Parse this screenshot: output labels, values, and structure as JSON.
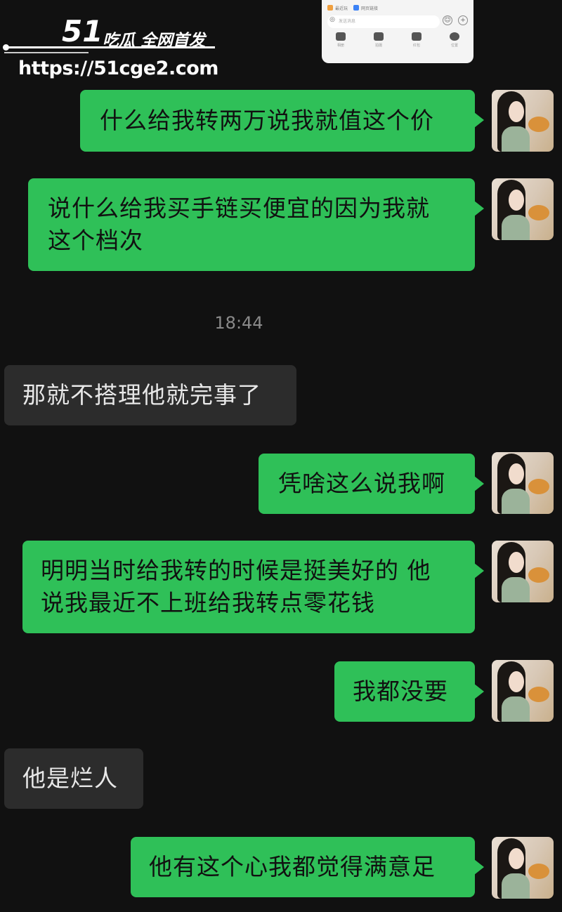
{
  "watermark": {
    "number": "51",
    "title": "吃瓜 全网首发",
    "url": "https://51cge2.com"
  },
  "embedded_card": {
    "chips": [
      "最近玩",
      "网页链接"
    ],
    "input_placeholder": "发送消息",
    "tools": [
      "相册",
      "拍摄",
      "红包",
      "位置"
    ]
  },
  "messages": [
    {
      "direction": "out",
      "text": "什么给我转两万说我就值这个价"
    },
    {
      "direction": "out",
      "line1": "说什么给我买手链买便宜的因为我就",
      "line2": "这个档次"
    },
    {
      "direction": "in",
      "text": "那就不搭理他就完事了"
    },
    {
      "direction": "out",
      "text": "凭啥这么说我啊"
    },
    {
      "direction": "out",
      "line1": "明明当时给我转的时候是挺美好的 他",
      "line2": "说我最近不上班给我转点零花钱"
    },
    {
      "direction": "out",
      "text": "我都没要"
    },
    {
      "direction": "in",
      "text": "他是烂人"
    },
    {
      "direction": "out",
      "text": "他有这个心我都觉得满意足"
    }
  ],
  "timestamp": "18:44",
  "colors": {
    "background": "#111111",
    "outgoing_bubble": "#2fc058",
    "incoming_bubble": "#2c2c2c"
  }
}
